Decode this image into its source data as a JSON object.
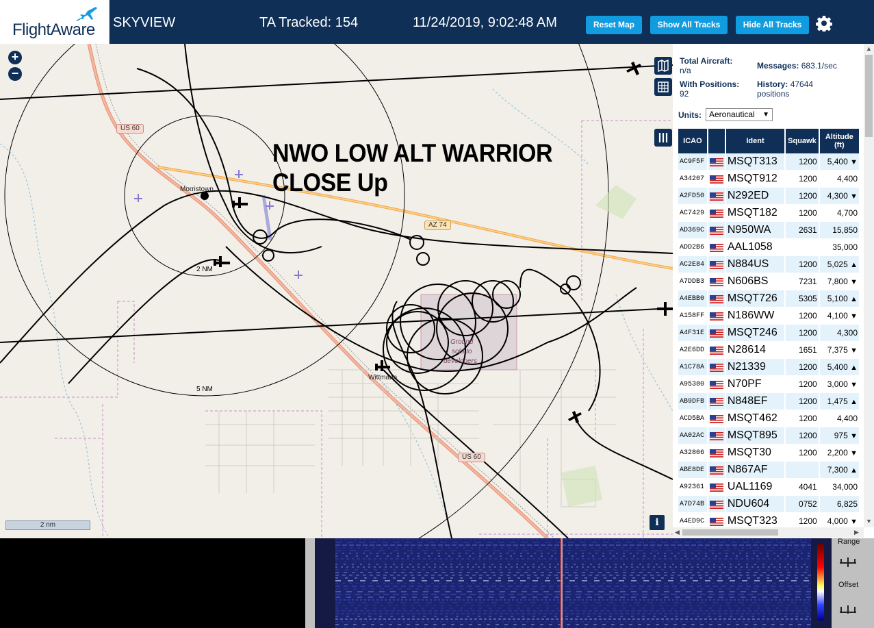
{
  "header": {
    "logo_text": "FlightAware",
    "app_title": "SKYVIEW",
    "tracked": "TA Tracked: 154",
    "datetime": "11/24/2019, 9:02:48 AM",
    "buttons": {
      "reset_map": "Reset Map",
      "show_all": "Show All Tracks",
      "hide_all": "Hide All Tracks"
    }
  },
  "map": {
    "annotation_line1": "NWO LOW ALT WARRIOR",
    "annotation_line2": "CLOSE Up",
    "labels": {
      "morristown": "Morristown",
      "wittmann": "Wittmann",
      "legacy": "Ground",
      "sold": "sold to",
      "dev": "developers"
    },
    "range_rings": {
      "inner": "2 NM",
      "outer": "5 NM"
    },
    "roads": {
      "us60_a": "US 60",
      "us60_b": "US 60",
      "az74": "AZ 74"
    },
    "scale": "2 nm",
    "zoom_in": "+",
    "zoom_out": "−",
    "info": "i"
  },
  "stats": {
    "total_label": "Total Aircraft:",
    "total_value": "n/a",
    "positions_label": "With Positions:",
    "positions_value": "92",
    "messages_label": "Messages:",
    "messages_value": "683.1/sec",
    "history_label": "History:",
    "history_value": "47644",
    "history_unit": "positions",
    "units_label": "Units:",
    "units_value": "Aeronautical"
  },
  "table": {
    "headers": {
      "icao": "ICAO",
      "ident": "Ident",
      "squawk": "Squawk",
      "altitude": "Altitude",
      "altitude_unit": "(ft)"
    },
    "rows": [
      {
        "icao": "AC9F5F",
        "ident": "MSQT313",
        "squawk": "1200",
        "alt": "5,400",
        "trend": "▼"
      },
      {
        "icao": "A34207",
        "ident": "MSQT912",
        "squawk": "1200",
        "alt": "4,400",
        "trend": ""
      },
      {
        "icao": "A2FD50",
        "ident": "N292ED",
        "squawk": "1200",
        "alt": "4,300",
        "trend": "▼"
      },
      {
        "icao": "AC7429",
        "ident": "MSQT182",
        "squawk": "1200",
        "alt": "4,700",
        "trend": ""
      },
      {
        "icao": "AD369C",
        "ident": "N950WA",
        "squawk": "2631",
        "alt": "15,850",
        "trend": ""
      },
      {
        "icao": "ADD2B6",
        "ident": "AAL1058",
        "squawk": "",
        "alt": "35,000",
        "trend": ""
      },
      {
        "icao": "AC2E84",
        "ident": "N884US",
        "squawk": "1200",
        "alt": "5,025",
        "trend": "▲"
      },
      {
        "icao": "A7DDB3",
        "ident": "N606BS",
        "squawk": "7231",
        "alt": "7,800",
        "trend": "▼"
      },
      {
        "icao": "A4EBB0",
        "ident": "MSQT726",
        "squawk": "5305",
        "alt": "5,100",
        "trend": "▲"
      },
      {
        "icao": "A158FF",
        "ident": "N186WW",
        "squawk": "1200",
        "alt": "4,100",
        "trend": "▼"
      },
      {
        "icao": "A4F31E",
        "ident": "MSQT246",
        "squawk": "1200",
        "alt": "4,300",
        "trend": ""
      },
      {
        "icao": "A2E6DD",
        "ident": "N28614",
        "squawk": "1651",
        "alt": "7,375",
        "trend": "▼"
      },
      {
        "icao": "A1C78A",
        "ident": "N21339",
        "squawk": "1200",
        "alt": "5,400",
        "trend": "▲"
      },
      {
        "icao": "A95380",
        "ident": "N70PF",
        "squawk": "1200",
        "alt": "3,000",
        "trend": "▼"
      },
      {
        "icao": "AB9DFB",
        "ident": "N848EF",
        "squawk": "1200",
        "alt": "1,475",
        "trend": "▲"
      },
      {
        "icao": "ACD5BA",
        "ident": "MSQT462",
        "squawk": "1200",
        "alt": "4,400",
        "trend": ""
      },
      {
        "icao": "AA02AC",
        "ident": "MSQT895",
        "squawk": "1200",
        "alt": "975",
        "trend": "▼"
      },
      {
        "icao": "A32806",
        "ident": "MSQT30",
        "squawk": "1200",
        "alt": "2,200",
        "trend": "▼"
      },
      {
        "icao": "ABE8DE",
        "ident": "N867AF",
        "squawk": "",
        "alt": "7,300",
        "trend": "▲"
      },
      {
        "icao": "A92361",
        "ident": "UAL1169",
        "squawk": "4041",
        "alt": "34,000",
        "trend": ""
      },
      {
        "icao": "A7D74B",
        "ident": "NDU604",
        "squawk": "0752",
        "alt": "6,825",
        "trend": ""
      },
      {
        "icao": "A4ED9C",
        "ident": "MSQT323",
        "squawk": "1200",
        "alt": "4,000",
        "trend": "▼"
      }
    ]
  },
  "waterfall": {
    "range_label": "Range",
    "offset_label": "Offset"
  },
  "colors": {
    "navy": "#0f2f57",
    "button": "#129ce0",
    "row_alt": "#e4f2fb"
  }
}
